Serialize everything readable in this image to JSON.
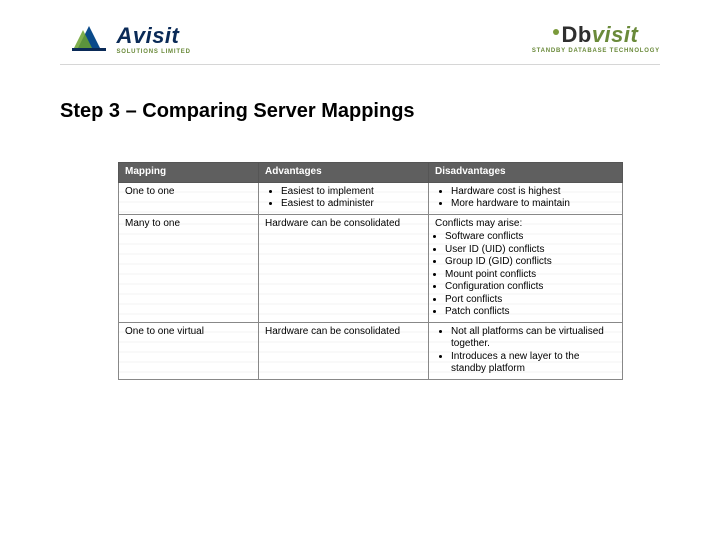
{
  "logos": {
    "left": {
      "brand": "Avisit",
      "sub": "SOLUTIONS LIMITED"
    },
    "right": {
      "brand_dark": "Db",
      "brand_green": "visit",
      "sub": "STANDBY DATABASE TECHNOLOGY"
    }
  },
  "title": "Step 3 – Comparing Server Mappings",
  "table": {
    "headers": {
      "mapping": "Mapping",
      "advantages": "Advantages",
      "disadvantages": "Disadvantages"
    },
    "rows": [
      {
        "mapping": "One to one",
        "advantages": {
          "items": [
            "Easiest to implement",
            "Easiest to administer"
          ]
        },
        "disadvantages": {
          "items": [
            "Hardware cost is highest",
            "More hardware to maintain"
          ]
        }
      },
      {
        "mapping": "Many to one",
        "advantages": {
          "text": "Hardware can be consolidated"
        },
        "disadvantages": {
          "lead": "Conflicts may arise:",
          "items": [
            "Software conflicts",
            "User ID (UID) conflicts",
            "Group ID (GID) conflicts",
            "Mount point conflicts",
            "Configuration conflicts",
            "Port conflicts",
            "Patch conflicts"
          ]
        }
      },
      {
        "mapping": "One to one virtual",
        "advantages": {
          "text": "Hardware can be consolidated"
        },
        "disadvantages": {
          "items": [
            "Not all platforms can be virtualised together.",
            "Introduces a new layer to the standby platform"
          ]
        }
      }
    ]
  }
}
